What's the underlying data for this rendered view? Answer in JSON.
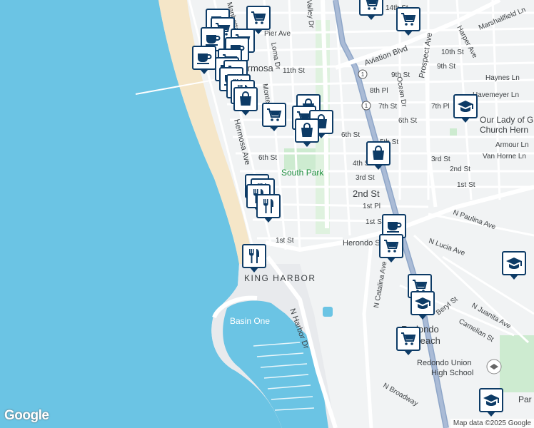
{
  "map": {
    "google_logo": "Google",
    "attribution": "Map data ©2025 Google"
  },
  "labels": {
    "streets": [
      {
        "name": "14th St"
      },
      {
        "name": "Pier Ave"
      },
      {
        "name": "Aviation Blvd"
      },
      {
        "name": "11th St"
      },
      {
        "name": "10th St"
      },
      {
        "name": "9th St"
      },
      {
        "name": "9th St"
      },
      {
        "name": "8th Pl"
      },
      {
        "name": "7th St"
      },
      {
        "name": "7th Pl"
      },
      {
        "name": "6th St"
      },
      {
        "name": "6th St"
      },
      {
        "name": "6th St"
      },
      {
        "name": "5th St"
      },
      {
        "name": "4th St"
      },
      {
        "name": "3rd St"
      },
      {
        "name": "3rd St"
      },
      {
        "name": "2nd St"
      },
      {
        "name": "2nd St"
      },
      {
        "name": "1st St"
      },
      {
        "name": "1st Pl"
      },
      {
        "name": "1st St"
      },
      {
        "name": "1st St"
      },
      {
        "name": "Loma Dr"
      },
      {
        "name": "Monterey Blvd"
      },
      {
        "name": "Hermosa Ave"
      },
      {
        "name": "Valley Dr"
      },
      {
        "name": "Ocean Dr"
      },
      {
        "name": "Prospect Ave"
      },
      {
        "name": "Harper Ave"
      },
      {
        "name": "Marshallfield Ln"
      },
      {
        "name": "Haynes Ln"
      },
      {
        "name": "Havemeyer Ln"
      },
      {
        "name": "Armour Ln"
      },
      {
        "name": "Van Horne Ln"
      },
      {
        "name": "N Paulina Ave"
      },
      {
        "name": "N Lucia Ave"
      },
      {
        "name": "Herondo St"
      },
      {
        "name": "N Catalina Ave"
      },
      {
        "name": "N Harbor Dr"
      },
      {
        "name": "Beryl St"
      },
      {
        "name": "N Juanita Ave"
      },
      {
        "name": "Camelian St"
      },
      {
        "name": "N Broadway"
      },
      {
        "name": "Manhattan Ave"
      }
    ],
    "places": [
      {
        "name": "South Park"
      },
      {
        "name": "KING HARBOR"
      },
      {
        "name": "Basin One"
      },
      {
        "name": "Redondo"
      },
      {
        "name": "Beach"
      },
      {
        "name": "Redondo Union"
      },
      {
        "name": "High School"
      },
      {
        "name": "Our Lady of G"
      },
      {
        "name": "Church Hern"
      },
      {
        "name": "Hermosa"
      },
      {
        "name": "Par"
      }
    ],
    "highway_shields": [
      "1",
      "1"
    ]
  },
  "pins": [
    {
      "type": "coffee"
    },
    {
      "type": "cart"
    },
    {
      "type": "cart"
    },
    {
      "type": "cart"
    },
    {
      "type": "cart"
    },
    {
      "type": "coffee"
    },
    {
      "type": "cart"
    },
    {
      "type": "coffee"
    },
    {
      "type": "coffee"
    },
    {
      "type": "cart"
    },
    {
      "type": "coffee"
    },
    {
      "type": "cart"
    },
    {
      "type": "coffee"
    },
    {
      "type": "restaurant"
    },
    {
      "type": "restaurant"
    },
    {
      "type": "cart"
    },
    {
      "type": "bag"
    },
    {
      "type": "cart"
    },
    {
      "type": "bag"
    },
    {
      "type": "bag"
    },
    {
      "type": "bag"
    },
    {
      "type": "school"
    },
    {
      "type": "bag"
    },
    {
      "type": "restaurant"
    },
    {
      "type": "restaurant"
    },
    {
      "type": "restaurant"
    },
    {
      "type": "restaurant"
    },
    {
      "type": "restaurant"
    },
    {
      "type": "coffee"
    },
    {
      "type": "cart"
    },
    {
      "type": "school"
    },
    {
      "type": "cart"
    },
    {
      "type": "school"
    },
    {
      "type": "cart"
    },
    {
      "type": "school"
    }
  ]
}
